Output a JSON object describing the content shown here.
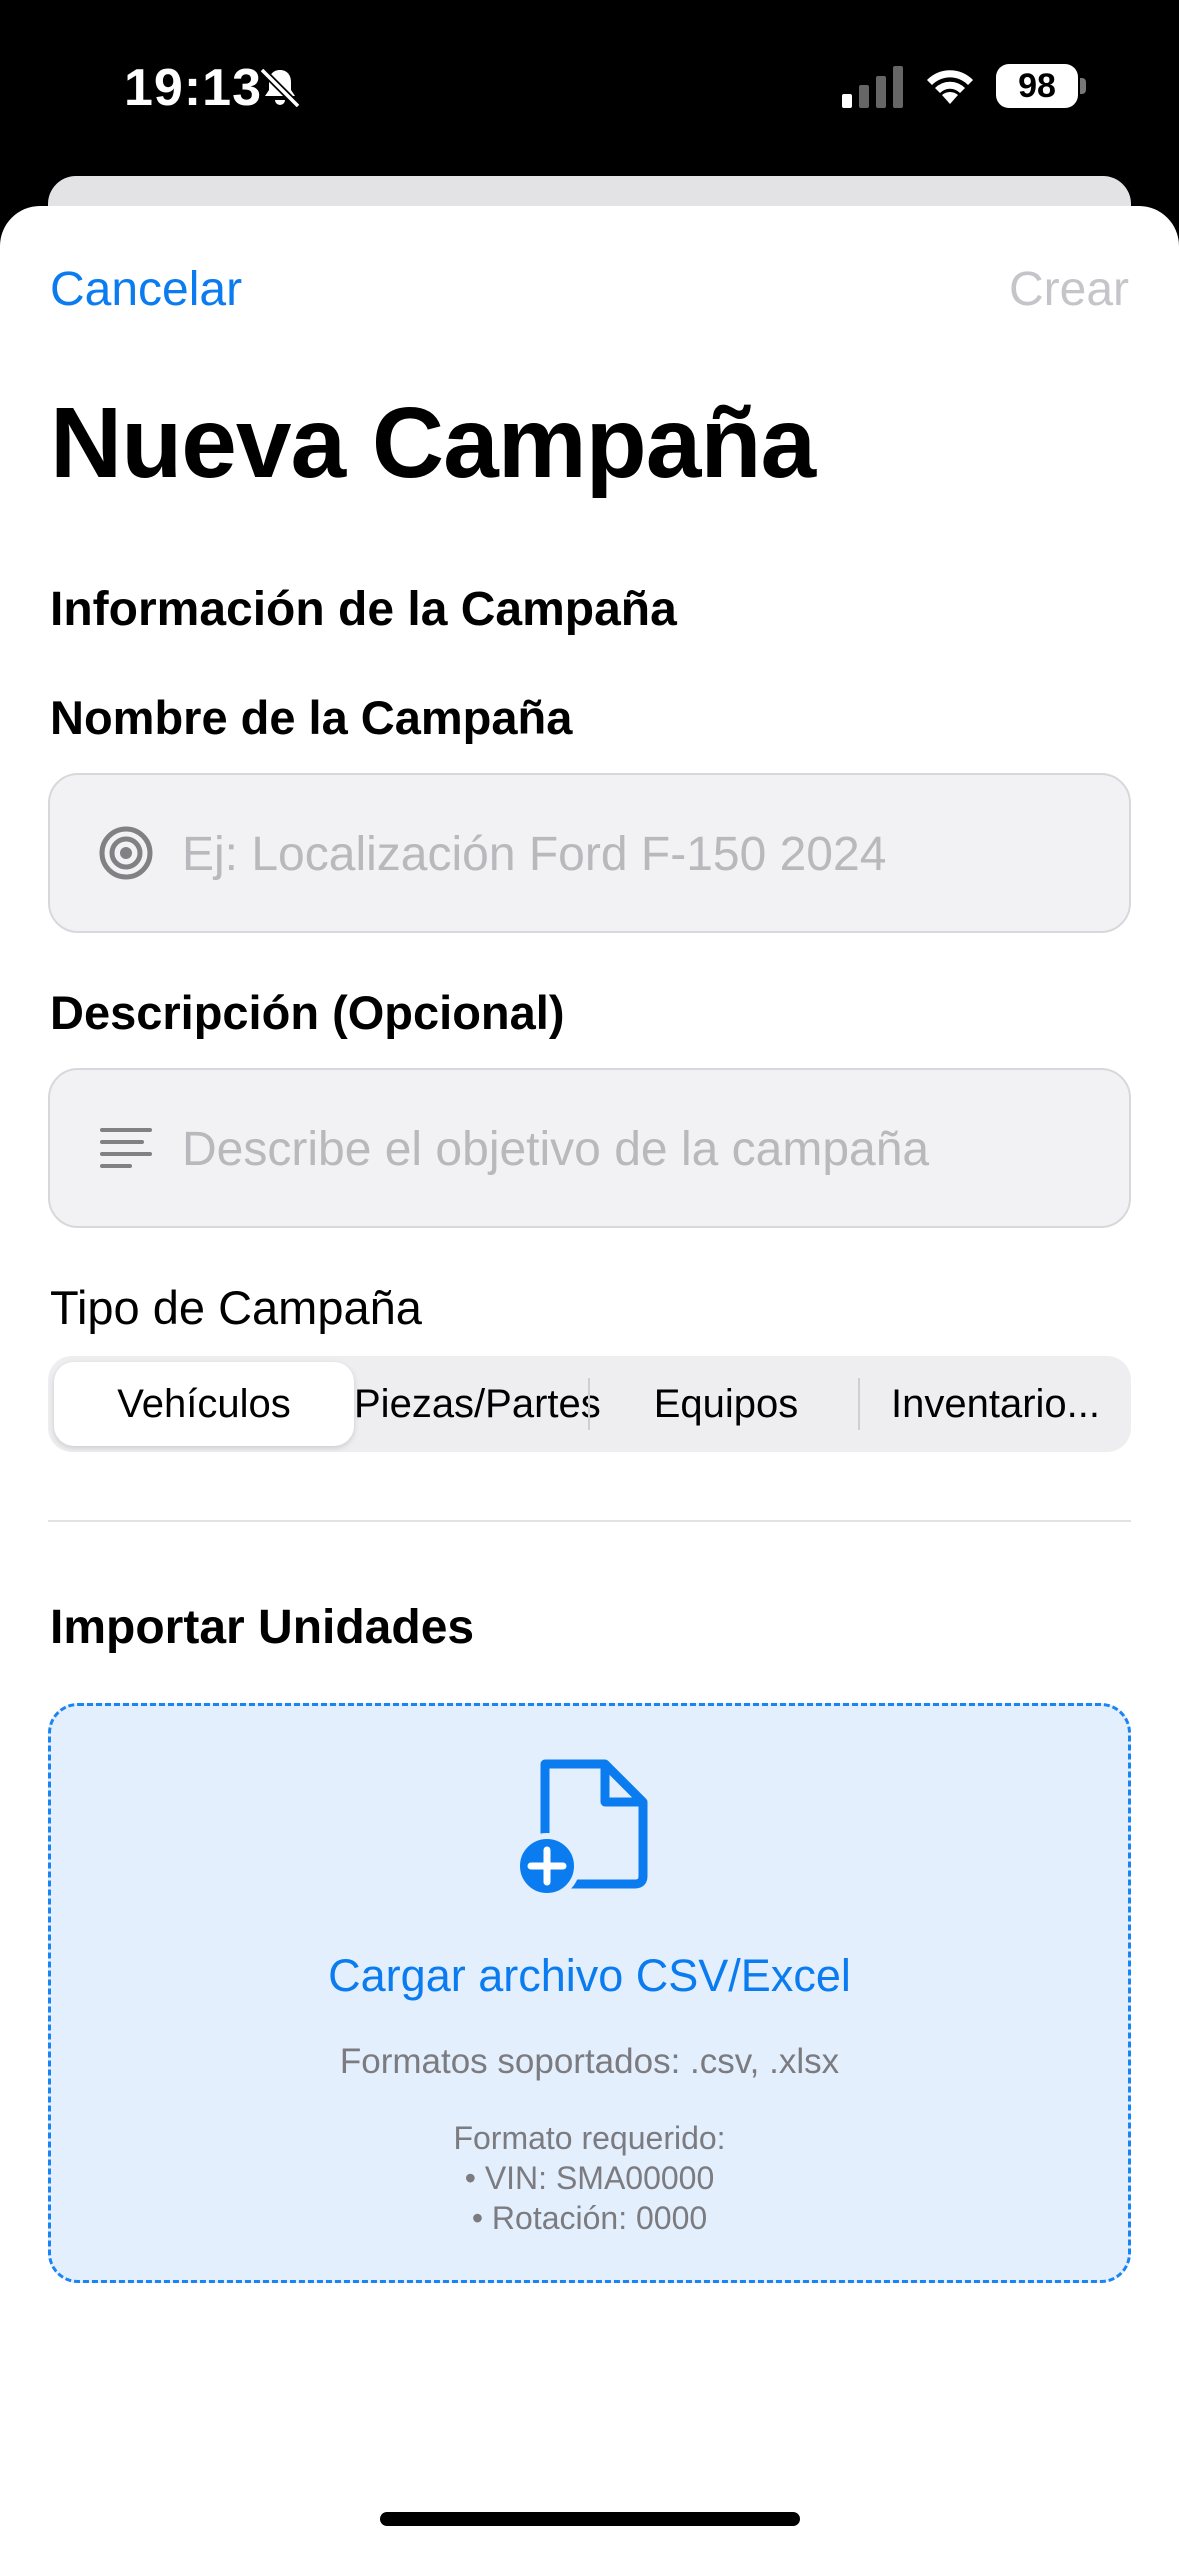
{
  "status_bar": {
    "time": "19:13",
    "battery": "98"
  },
  "nav": {
    "cancel": "Cancelar",
    "create": "Crear"
  },
  "title": "Nueva Campaña",
  "info_section": {
    "heading": "Información de la Campaña"
  },
  "name_field": {
    "label": "Nombre de la Campaña",
    "placeholder": "Ej: Localización Ford F-150 2024"
  },
  "description_field": {
    "label": "Descripción (Opcional)",
    "placeholder": "Describe el objetivo de la campaña"
  },
  "type_picker": {
    "label": "Tipo de Campaña",
    "options": [
      "Vehículos",
      "Piezas/Partes",
      "Equipos",
      "Inventario..."
    ],
    "selected": "Vehículos"
  },
  "import_section": {
    "heading": "Importar Unidades",
    "upload_label": "Cargar archivo CSV/Excel",
    "formats": "Formatos soportados: .csv, .xlsx",
    "required_title": "Formato requerido:",
    "required_lines": [
      "• VIN: SMA00000",
      "• Rotación: 0000"
    ]
  },
  "colors": {
    "accent": "#0a7cf0",
    "drop_bg": "#e3effd",
    "disabled": "#c5c5c9"
  }
}
